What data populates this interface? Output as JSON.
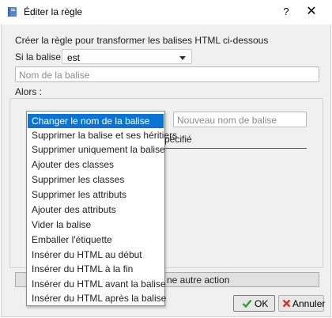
{
  "window": {
    "title": "Éditer la règle",
    "help_glyph": "?",
    "close_glyph": "✕"
  },
  "form": {
    "instruction": "Créer la règle pour transformer les balises HTML ci-dessous",
    "if_tag_label": "Si la balise",
    "condition_value": "est",
    "tag_name_placeholder": "Nom de la balise",
    "then_label": "Alors :",
    "new_tag_placeholder": "Nouveau nom de balise",
    "partial_text": "pécifié",
    "add_action_label": "ne autre action"
  },
  "action_dropdown": {
    "selected_index": 0,
    "options": [
      "Changer le nom de la balise",
      "Supprimer la balise et ses héritiers",
      "Supprimer uniquement la balise",
      "Ajouter des classes",
      "Supprimer les classes",
      "Supprimer les attributs",
      "Ajouter des attributs",
      "Vider la balise",
      "Emballer l'étiquette",
      "Insérer du HTML au début",
      "Insérer du HTML à la fin",
      "Insérer du HTML avant la balise",
      "Insérer du HTML après la balise"
    ]
  },
  "buttons": {
    "ok_label": "OK",
    "cancel_label": "Annuler"
  },
  "colors": {
    "selection": "#0a74d6",
    "ok_check": "#2e9e2e",
    "cancel_x": "#d0312d"
  }
}
